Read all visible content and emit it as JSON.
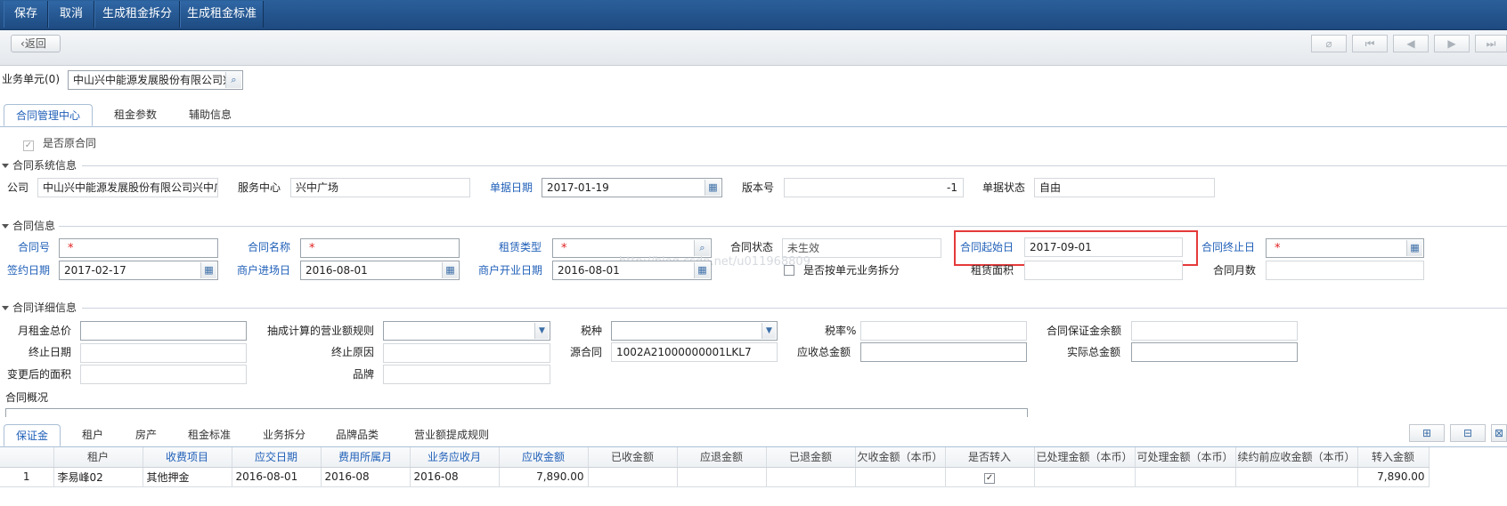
{
  "toolbar": {
    "save": "保存",
    "cancel": "取消",
    "gen_split": "生成租金拆分",
    "gen_standard": "生成租金标准"
  },
  "nav": {
    "back": "返回",
    "icons": [
      "paperclip-icon",
      "first-icon",
      "prev-icon",
      "next-icon",
      "last-icon"
    ]
  },
  "org": {
    "label": "业务单元(0)",
    "value": "中山兴中能源发展股份有限公司兴"
  },
  "main_tabs": [
    "合同管理中心",
    "租金参数",
    "辅助信息"
  ],
  "original_contract": {
    "label": "是否原合同",
    "checked": true
  },
  "sys_section": {
    "title": "合同系统信息",
    "company_label": "公司",
    "company_value": "中山兴中能源发展股份有限公司兴中广",
    "service_label": "服务中心",
    "service_value": "兴中广场",
    "doc_date_label": "单据日期",
    "doc_date_value": "2017-01-19",
    "version_label": "版本号",
    "version_value": "-1",
    "status_label": "单据状态",
    "status_value": "自由"
  },
  "info_section": {
    "title": "合同信息",
    "contract_no": "合同号",
    "contract_name": "合同名称",
    "lease_type": "租赁类型",
    "contract_status": "合同状态",
    "contract_status_value": "未生效",
    "start_date": "合同起始日",
    "start_date_value": "2017-09-01",
    "end_date": "合同终止日",
    "sign_date": "签约日期",
    "sign_date_value": "2017-02-17",
    "enter_date": "商户进场日",
    "enter_date_value": "2016-08-01",
    "open_date": "商户开业日期",
    "open_date_value": "2016-08-01",
    "split_by_unit": "是否按单元业务拆分",
    "lease_area": "租赁面积",
    "months": "合同月数",
    "required_mark": "*",
    "watermark": "http://blog.csdn.net/u011968809"
  },
  "detail_section": {
    "title": "合同详细信息",
    "monthly_total": "月租金总价",
    "commission_rule": "抽成计算的营业额规则",
    "tax_type": "税种",
    "tax_rate": "税率%",
    "deposit_balance": "合同保证金余额",
    "stop_date": "终止日期",
    "stop_reason": "终止原因",
    "source_contract": "源合同",
    "source_contract_value": "1002A21000000001LKL7",
    "receivable_total": "应收总金额",
    "actual_total": "实际总金额",
    "changed_area": "变更后的面积",
    "brand": "品牌",
    "overview": "合同概况"
  },
  "bottom_tabs": [
    "保证金",
    "租户",
    "房产",
    "租金标准",
    "业务拆分",
    "品牌品类",
    "营业额提成规则"
  ],
  "grid": {
    "headers": [
      "",
      "租户",
      "收费项目",
      "应交日期",
      "费用所属月",
      "业务应收月",
      "应收金额",
      "已收金额",
      "应退金额",
      "已退金额",
      "欠收金额（本币）",
      "是否转入",
      "已处理金额（本币）",
      "可处理金额（本币）",
      "续约前应收金额（本币）",
      "转入金额"
    ],
    "rows": [
      [
        "1",
        "李易峰02",
        "其他押金",
        "2016-08-01",
        "2016-08",
        "2016-08",
        "7,890.00",
        "",
        "",
        "",
        "",
        "✓",
        "",
        "",
        "",
        "7,890.00"
      ]
    ]
  }
}
